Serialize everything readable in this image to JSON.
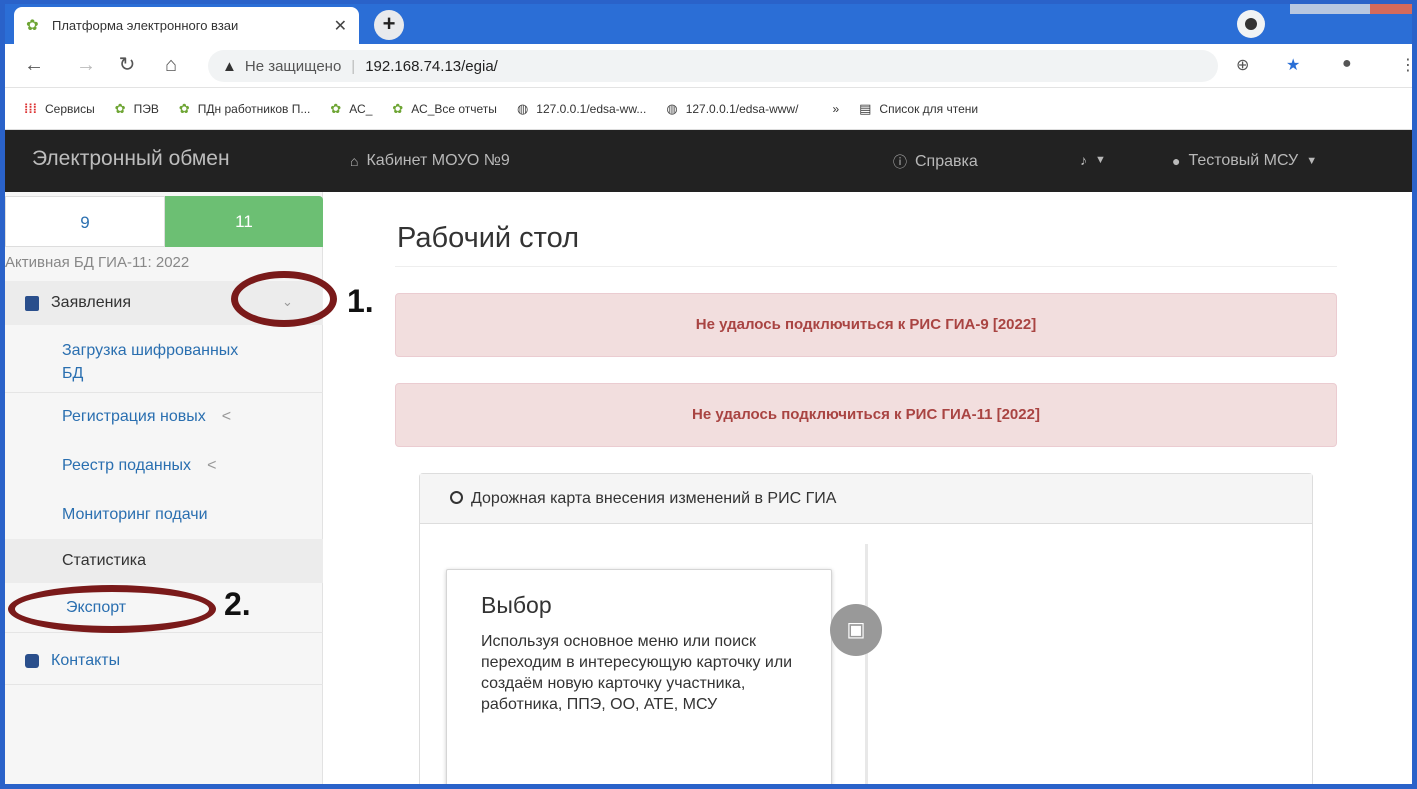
{
  "browser": {
    "tab_title": "Платформа электронного взаи",
    "tab_close": "✕",
    "new_tab": "+",
    "security_label": "Не защищено",
    "url": "192.168.74.13/egia/",
    "bookmarks": [
      {
        "label": "Сервисы",
        "icon": "apps-icon"
      },
      {
        "label": "ПЭВ",
        "icon": "leaf-icon"
      },
      {
        "label": "ПДн работников П...",
        "icon": "leaf-icon"
      },
      {
        "label": "АС_",
        "icon": "leaf-icon"
      },
      {
        "label": "АС_Все отчеты",
        "icon": "leaf-icon"
      },
      {
        "label": "127.0.0.1/edsa-ww...",
        "icon": "globe-icon"
      },
      {
        "label": "127.0.0.1/edsa-www/",
        "icon": "globe-icon"
      }
    ],
    "bookmarks_overflow": "»",
    "reading_list": "Список для чтени"
  },
  "navbar": {
    "brand": "Электронный обмен",
    "cabinet": "Кабинет МОУО №9",
    "help": "Справка",
    "user": "Тестовый МСУ"
  },
  "sidebar": {
    "switch_9": "9",
    "switch_11": "11",
    "active_db": "Активная БД ГИА-11: 2022",
    "menu_applications": "Заявления",
    "items": [
      {
        "label": "Загрузка шифрованных БД"
      },
      {
        "label": "Регистрация новых",
        "arrow": "<"
      },
      {
        "label": "Реестр поданных",
        "arrow": "<"
      },
      {
        "label": "Мониторинг подачи"
      },
      {
        "label": "Статистика"
      },
      {
        "label": "Экспорт"
      }
    ],
    "contacts": "Контакты"
  },
  "main": {
    "title": "Рабочий стол",
    "alerts": [
      "Не удалось подключиться к РИС ГИА-9 [2022]",
      "Не удалось подключиться к РИС ГИА-11 [2022]"
    ],
    "panel_title": "Дорожная карта внесения изменений в РИС ГИА",
    "card_title": "Выбор",
    "card_text": "Используя основное меню или поиск переходим в интересующую карточку или создаём новую карточку участника, работника, ППЭ, ОО, АТЕ, МСУ"
  },
  "annotations": {
    "step1": "1.",
    "step2": "2."
  },
  "colors": {
    "navbar_bg": "#222222",
    "active_switch": "#6cbf73",
    "alert_bg": "#f2dede",
    "alert_text": "#a94442",
    "link": "#2a6fb0",
    "annotation_ring": "#7a1a1a"
  }
}
